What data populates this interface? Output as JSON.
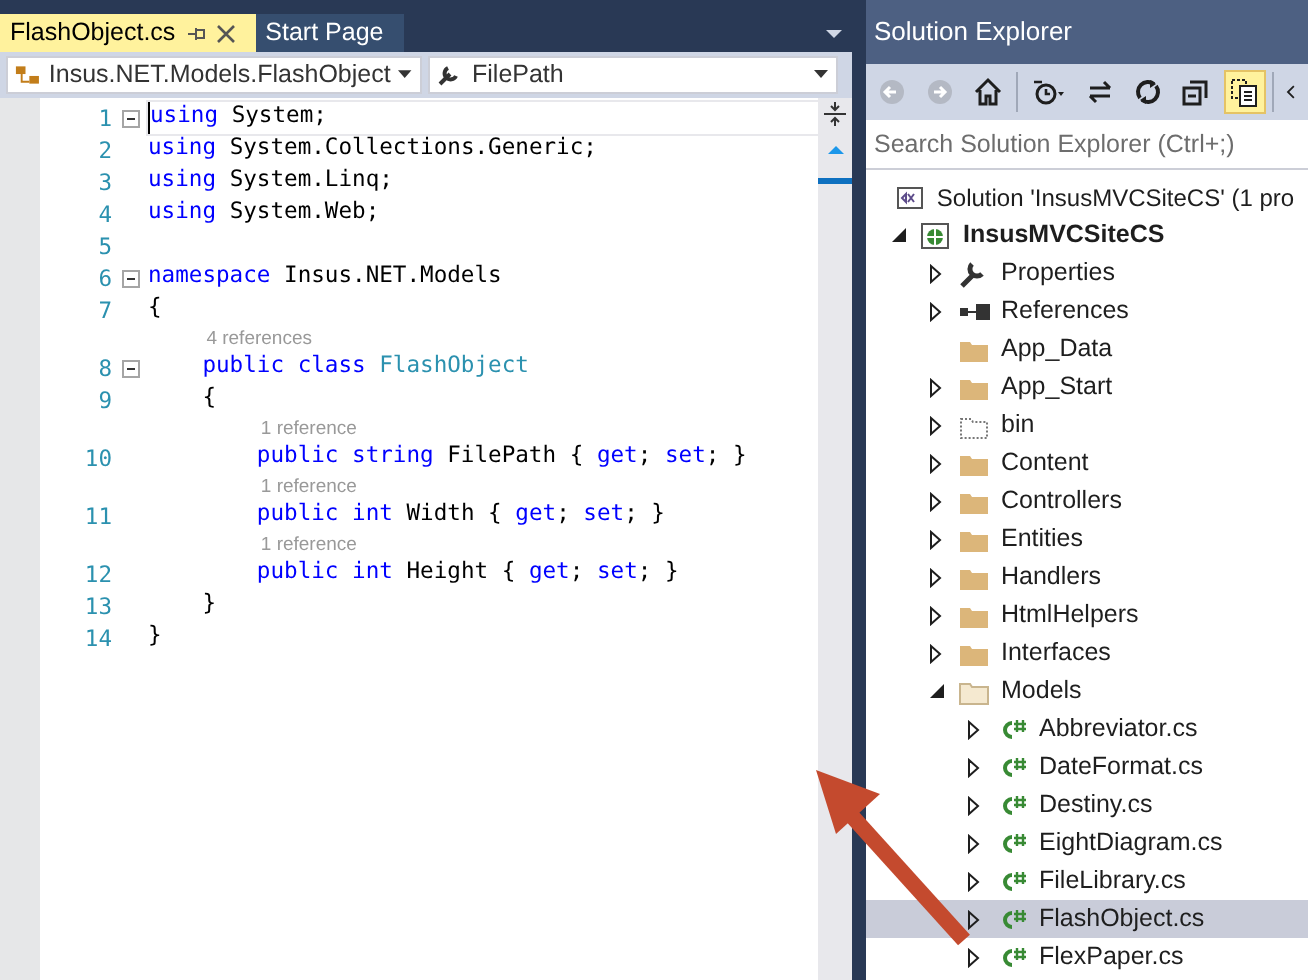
{
  "editor": {
    "tabs": [
      {
        "label": "FlashObject.cs",
        "selected": true
      },
      {
        "label": "Start Page",
        "selected": false
      }
    ],
    "navigation": [
      {
        "kind": "class",
        "value": "Insus.NET.Models.FlashObject"
      },
      {
        "kind": "member",
        "value": "FilePath"
      }
    ],
    "lines": [
      {
        "number": "1",
        "collapsible": true,
        "current": true,
        "tokens": [
          {
            "kind": "keyword",
            "text": "using"
          },
          {
            "kind": "plain",
            "text": " System;"
          }
        ]
      },
      {
        "number": "2",
        "collapsible": false,
        "current": false,
        "tokens": [
          {
            "kind": "keyword",
            "text": "using"
          },
          {
            "kind": "plain",
            "text": " System.Collections.Generic;"
          }
        ]
      },
      {
        "number": "3",
        "collapsible": false,
        "current": false,
        "tokens": [
          {
            "kind": "keyword",
            "text": "using"
          },
          {
            "kind": "plain",
            "text": " System.Linq;"
          }
        ]
      },
      {
        "number": "4",
        "collapsible": false,
        "current": false,
        "tokens": [
          {
            "kind": "keyword",
            "text": "using"
          },
          {
            "kind": "plain",
            "text": " System.Web;"
          }
        ]
      },
      {
        "number": "5",
        "collapsible": false,
        "current": false
      },
      {
        "number": "6",
        "collapsible": true,
        "current": false,
        "tokens": [
          {
            "kind": "keyword",
            "text": "namespace"
          },
          {
            "kind": "plain",
            "text": " Insus.NET.Models"
          }
        ]
      },
      {
        "number": "7",
        "collapsible": false,
        "current": false,
        "tokens": [
          {
            "kind": "plain",
            "text": "{"
          }
        ]
      },
      {
        "number": "8",
        "collapsible": true,
        "current": false,
        "references": "4 references",
        "tokens": [
          {
            "kind": "keyword",
            "text": "    public"
          },
          {
            "kind": "keyword",
            "text": " class"
          },
          {
            "kind": "type",
            "text": " FlashObject"
          }
        ]
      },
      {
        "number": "9",
        "collapsible": false,
        "current": false,
        "tokens": [
          {
            "kind": "plain",
            "text": "    {"
          }
        ]
      },
      {
        "number": "10",
        "collapsible": false,
        "current": false,
        "references": "1 reference",
        "tokens": [
          {
            "kind": "keyword",
            "text": "        public"
          },
          {
            "kind": "keyword",
            "text": " string"
          },
          {
            "kind": "plain",
            "text": " FilePath { "
          },
          {
            "kind": "keyword",
            "text": "get"
          },
          {
            "kind": "plain",
            "text": "; "
          },
          {
            "kind": "keyword",
            "text": "set"
          },
          {
            "kind": "plain",
            "text": "; }"
          }
        ]
      },
      {
        "number": "11",
        "collapsible": false,
        "current": false,
        "references": "1 reference",
        "tokens": [
          {
            "kind": "keyword",
            "text": "        public"
          },
          {
            "kind": "keyword",
            "text": " int"
          },
          {
            "kind": "plain",
            "text": " Width { "
          },
          {
            "kind": "keyword",
            "text": "get"
          },
          {
            "kind": "plain",
            "text": "; "
          },
          {
            "kind": "keyword",
            "text": "set"
          },
          {
            "kind": "plain",
            "text": "; }"
          }
        ]
      },
      {
        "number": "12",
        "collapsible": false,
        "current": false,
        "references": "1 reference",
        "tokens": [
          {
            "kind": "keyword",
            "text": "        public"
          },
          {
            "kind": "keyword",
            "text": " int"
          },
          {
            "kind": "plain",
            "text": " Height { "
          },
          {
            "kind": "keyword",
            "text": "get"
          },
          {
            "kind": "plain",
            "text": "; "
          },
          {
            "kind": "keyword",
            "text": "set"
          },
          {
            "kind": "plain",
            "text": "; }"
          }
        ]
      },
      {
        "number": "13",
        "collapsible": false,
        "current": false,
        "tokens": [
          {
            "kind": "plain",
            "text": "    }"
          }
        ]
      },
      {
        "number": "14",
        "collapsible": false,
        "current": false,
        "tokens": [
          {
            "kind": "plain",
            "text": "}"
          }
        ]
      }
    ]
  },
  "solution_explorer": {
    "title": "Solution Explorer",
    "toolbar": [
      {
        "kind": "back",
        "disabled": true,
        "selected": false
      },
      {
        "kind": "forward",
        "disabled": true,
        "selected": false
      },
      {
        "kind": "home",
        "disabled": false,
        "selected": false
      },
      {
        "kind": "history",
        "disabled": false,
        "selected": false
      },
      {
        "kind": "sync",
        "disabled": false,
        "selected": false
      },
      {
        "kind": "refresh",
        "disabled": false,
        "selected": false
      },
      {
        "kind": "collapse",
        "disabled": false,
        "selected": false
      },
      {
        "kind": "show-all",
        "disabled": false,
        "selected": true
      },
      {
        "kind": "chevron",
        "disabled": false,
        "selected": false
      }
    ],
    "search": {
      "placeholder": "Search Solution Explorer (Ctrl+;)"
    },
    "tree": [
      {
        "label": "Solution 'InsusMVCSiteCS' (1 pro",
        "kind": "solution",
        "selected": false,
        "children": [
          {
            "label": "InsusMVCSiteCS",
            "kind": "project",
            "expanded": true,
            "selected": false,
            "children": [
              {
                "label": "Properties",
                "kind": "wrench",
                "expanded": false,
                "selected": false
              },
              {
                "label": "References",
                "kind": "references",
                "expanded": false,
                "selected": false
              },
              {
                "label": "App_Data",
                "kind": "folder",
                "selected": false
              },
              {
                "label": "App_Start",
                "kind": "folder",
                "expanded": false,
                "selected": false
              },
              {
                "label": "bin",
                "kind": "hidden-folder",
                "expanded": false,
                "selected": false
              },
              {
                "label": "Content",
                "kind": "folder",
                "expanded": false,
                "selected": false
              },
              {
                "label": "Controllers",
                "kind": "folder",
                "expanded": false,
                "selected": false
              },
              {
                "label": "Entities",
                "kind": "folder",
                "expanded": false,
                "selected": false
              },
              {
                "label": "Handlers",
                "kind": "folder",
                "expanded": false,
                "selected": false
              },
              {
                "label": "HtmlHelpers",
                "kind": "folder",
                "expanded": false,
                "selected": false
              },
              {
                "label": "Interfaces",
                "kind": "folder",
                "expanded": false,
                "selected": false
              },
              {
                "label": "Models",
                "kind": "open-folder",
                "expanded": true,
                "selected": false,
                "children": [
                  {
                    "label": "Abbreviator.cs",
                    "kind": "csharp",
                    "expanded": false,
                    "selected": false
                  },
                  {
                    "label": "DateFormat.cs",
                    "kind": "csharp",
                    "expanded": false,
                    "selected": false
                  },
                  {
                    "label": "Destiny.cs",
                    "kind": "csharp",
                    "expanded": false,
                    "selected": false
                  },
                  {
                    "label": "EightDiagram.cs",
                    "kind": "csharp",
                    "expanded": false,
                    "selected": false
                  },
                  {
                    "label": "FileLibrary.cs",
                    "kind": "csharp",
                    "expanded": false,
                    "selected": false
                  },
                  {
                    "label": "FlashObject.cs",
                    "kind": "csharp",
                    "expanded": false,
                    "selected": true
                  },
                  {
                    "label": "FlexPaper.cs",
                    "kind": "csharp",
                    "expanded": false,
                    "selected": false
                  }
                ]
              }
            ]
          }
        ]
      }
    ]
  }
}
